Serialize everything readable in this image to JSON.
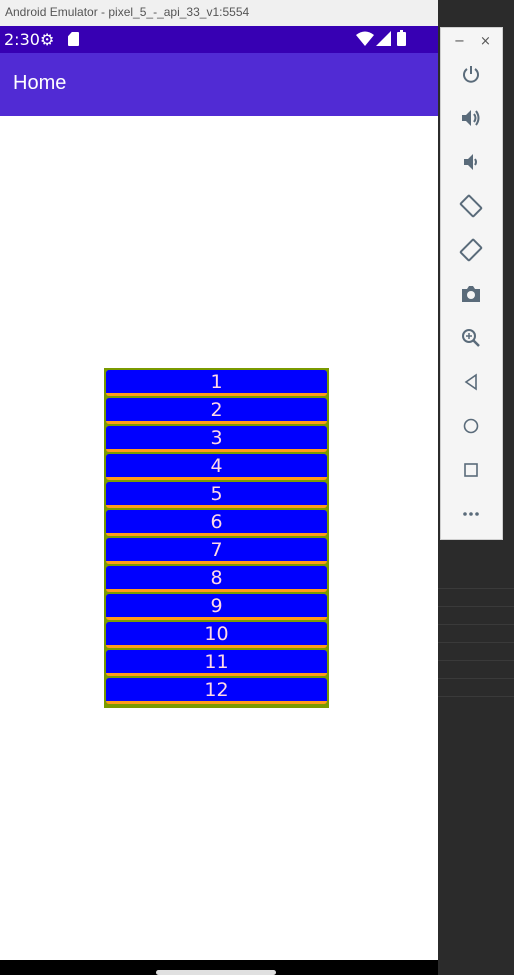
{
  "window": {
    "title": "Android Emulator - pixel_5_-_api_33_v1:5554"
  },
  "status_bar": {
    "time": "2:30"
  },
  "app_bar": {
    "title": "Home"
  },
  "list": {
    "items": [
      "1",
      "2",
      "3",
      "4",
      "5",
      "6",
      "7",
      "8",
      "9",
      "10",
      "11",
      "12"
    ]
  },
  "emulator_controls": {
    "minimize": "−",
    "close": "×",
    "buttons": [
      "power-icon",
      "volume-up-icon",
      "volume-down-icon",
      "rotate-left-icon",
      "rotate-right-icon",
      "camera-icon",
      "zoom-icon",
      "back-icon",
      "home-icon",
      "overview-icon",
      "more-icon"
    ]
  },
  "colors": {
    "status_bar": "#3700b3",
    "app_bar": "#512bd4",
    "item_bg": "#0000ff",
    "item_text": "#ffd9e6",
    "item_border": "#ff9b1a",
    "list_bg": "#7a9a00"
  }
}
